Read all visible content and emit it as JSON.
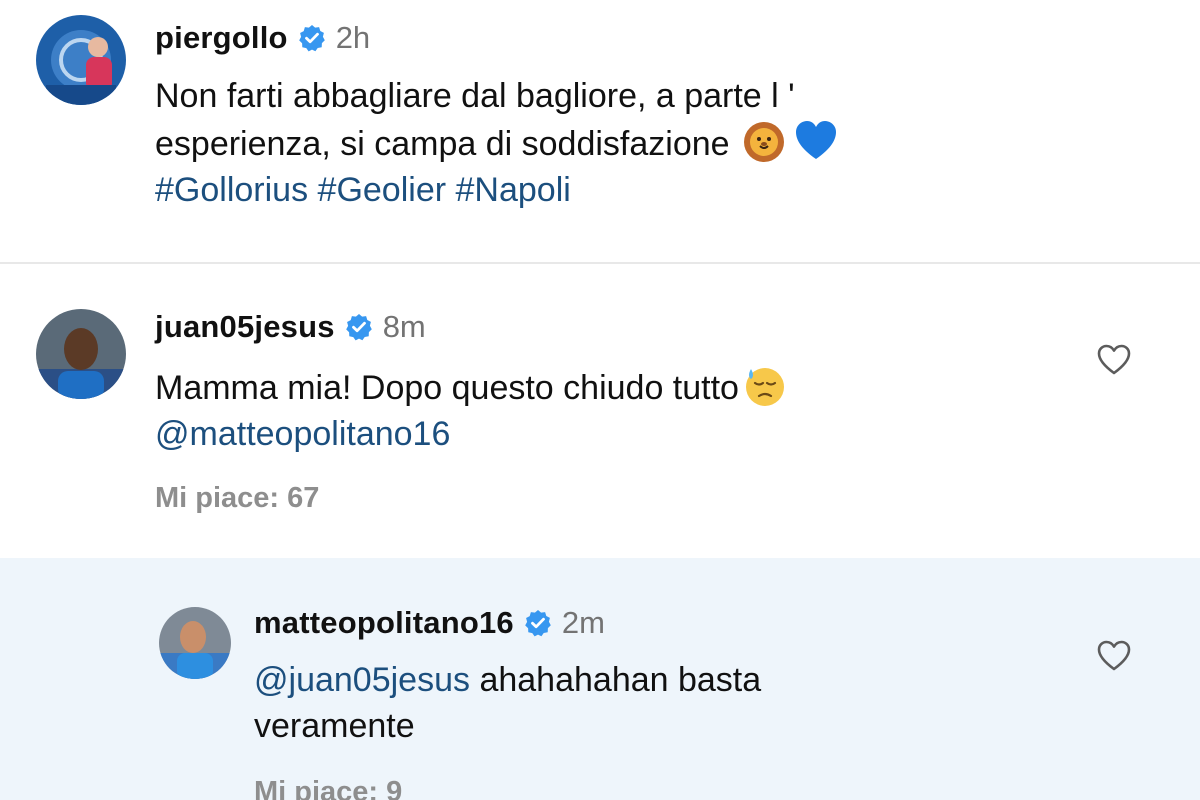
{
  "caption": {
    "username": "piergollo",
    "time": "2h",
    "text_line1": "Non farti abbagliare dal bagliore, a parte l '",
    "text_line2": "esperienza, si campa di soddisfazione",
    "hashtags": [
      "#Gollorius",
      "#Geolier",
      "#Napoli"
    ],
    "emojis": [
      "lion-face-emoji",
      "blue-heart-emoji"
    ]
  },
  "comment": {
    "username": "juan05jesus",
    "time": "8m",
    "text_line1": "Mamma mia! Dopo questo chiudo tutto",
    "emoji": "downcast-face-with-sweat-emoji",
    "mention": "@matteopolitano16",
    "likes": "Mi piace: 67"
  },
  "reply": {
    "username": "matteopolitano16",
    "time": "2m",
    "mention": "@juan05jesus",
    "text_line1_rest": "ahahahahan basta",
    "text_line2": "veramente",
    "likes": "Mi piace: 9"
  },
  "colors": {
    "text": "#111111",
    "muted": "#737373",
    "likes": "#8e8e8e",
    "link": "#1c4f7e",
    "verified": "#3797f0",
    "reply_background": "#eef5fb",
    "divider": "#e8e8e8"
  }
}
